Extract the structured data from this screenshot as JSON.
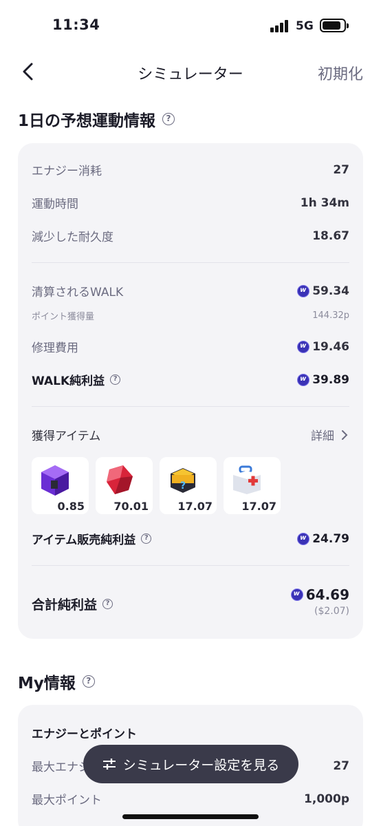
{
  "status_bar": {
    "time": "11:34",
    "network": "5G"
  },
  "nav": {
    "title": "シミュレーター",
    "reset_label": "初期化"
  },
  "daily": {
    "title": "1日の予想運動情報",
    "rows": {
      "energy": {
        "label": "エナジー消耗",
        "value": "27"
      },
      "time": {
        "label": "運動時間",
        "value": "1h 34m"
      },
      "durability": {
        "label": "減少した耐久度",
        "value": "18.67"
      },
      "walk_settled": {
        "label": "清算されるWALK",
        "value": "59.34"
      },
      "points": {
        "label": "ポイント獲得量",
        "value": "144.32p"
      },
      "repair": {
        "label": "修理費用",
        "value": "19.46"
      },
      "walk_net": {
        "label": "WALK純利益",
        "value": "39.89"
      }
    },
    "items_section": {
      "label": "獲得アイテム",
      "detail_label": "詳細"
    },
    "items": [
      {
        "icon": "purple-box-icon",
        "qty": "0.85"
      },
      {
        "icon": "red-gem-icon",
        "qty": "70.01"
      },
      {
        "icon": "mystery-box-icon",
        "qty": "17.07"
      },
      {
        "icon": "repair-kit-icon",
        "qty": "17.07"
      }
    ],
    "item_net": {
      "label": "アイテム販売純利益",
      "value": "24.79"
    },
    "total": {
      "label": "合計純利益",
      "value": "64.69",
      "usd": "($2.07)"
    }
  },
  "my_info": {
    "title": "My情報",
    "card_title": "エナジーとポイント",
    "rows": {
      "max_energy": {
        "label": "最大エナジー",
        "value": "27"
      },
      "max_points": {
        "label": "最大ポイント",
        "value": "1,000p"
      }
    }
  },
  "toast": {
    "label": "シミュレーター設定を見る"
  },
  "colors": {
    "coin": "#3a32b6",
    "card_bg": "#f4f4f7",
    "toast_bg": "#3a3a4a"
  }
}
